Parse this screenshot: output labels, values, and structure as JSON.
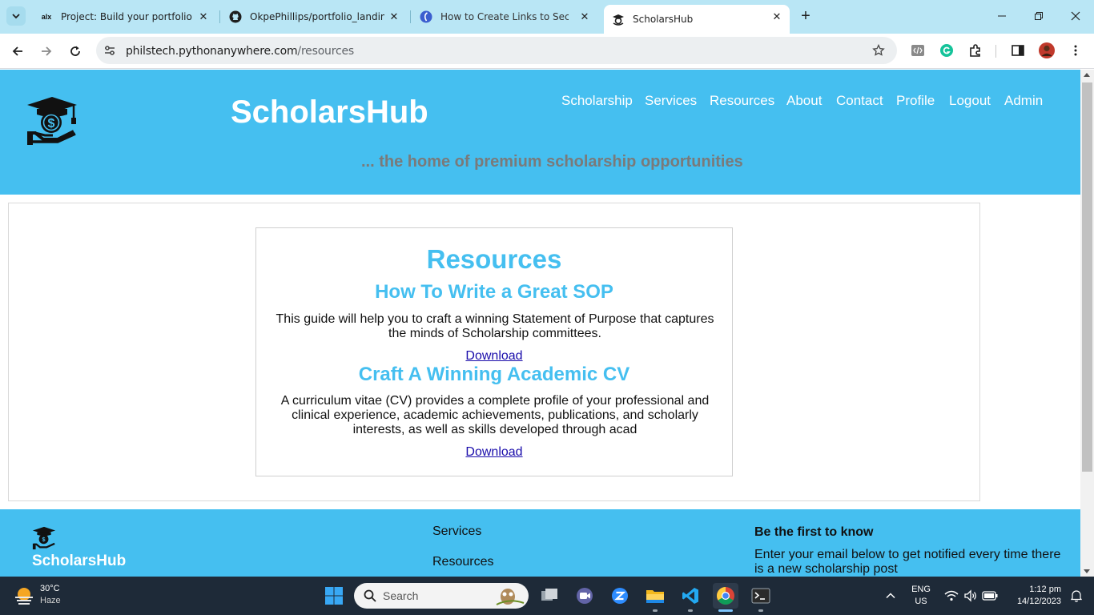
{
  "browser": {
    "tabs": [
      {
        "label": "Project: Build your portfolio pro",
        "favicon": "alx-icon"
      },
      {
        "label": "OkpePhillips/portfolio_landing_",
        "favicon": "github-icon"
      },
      {
        "label": "How to Create Links to Sections",
        "favicon": "freecodecamp-icon"
      },
      {
        "label": "ScholarsHub",
        "favicon": "scholarshub-icon",
        "active": true
      }
    ],
    "url_host": "philstech.pythonanywhere.com",
    "url_path": "/resources"
  },
  "site": {
    "brand": "ScholarsHub",
    "tagline": "... the home of premium scholarship opportunities",
    "nav": [
      "Scholarship",
      "Services",
      "Resources",
      "About",
      "Contact",
      "Profile",
      "Logout",
      "Admin"
    ],
    "colors": {
      "primary": "#45bff0",
      "tagline": "#7a7a7a",
      "link": "#1a0dab"
    }
  },
  "main": {
    "heading": "Resources",
    "resources": [
      {
        "title": "How To Write a Great SOP",
        "description": "This guide will help you to craft a winning Statement of Purpose that captures the minds of Scholarship committees.",
        "link": "Download"
      },
      {
        "title": "Craft A Winning Academic CV",
        "description": "A curriculum vitae (CV) provides a complete profile of your professional and clinical experience, academic achievements, publications, and scholarly interests, as well as skills developed through acad",
        "link": "Download"
      }
    ]
  },
  "footer": {
    "brand": "ScholarsHub",
    "links": [
      "Services",
      "Resources"
    ],
    "newsletter_heading": "Be the first to know",
    "newsletter_text": "Enter your email below to get notified every time there is a new scholarship post"
  },
  "taskbar": {
    "temperature": "30°C",
    "condition": "Haze",
    "search_label": "Search",
    "lang_line1": "ENG",
    "lang_line2": "US",
    "time": "1:12 pm",
    "date": "14/12/2023"
  }
}
